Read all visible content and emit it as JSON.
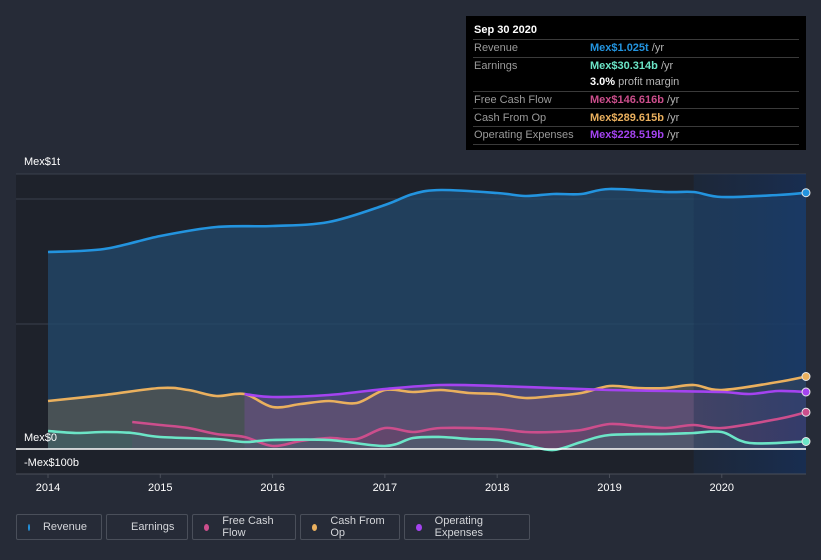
{
  "tooltip": {
    "date": "Sep 30 2020",
    "rows": [
      {
        "label": "Revenue",
        "value": "Mex$1.025t",
        "unit": " /yr",
        "color": "#2394df"
      },
      {
        "label": "Earnings",
        "value": "Mex$30.314b",
        "unit": " /yr",
        "color": "#6ce5c7"
      },
      {
        "label": "",
        "value": "3.0%",
        "unit": " profit margin",
        "color": "#ffffff"
      },
      {
        "label": "Free Cash Flow",
        "value": "Mex$146.616b",
        "unit": " /yr",
        "color": "#cc4e8c"
      },
      {
        "label": "Cash From Op",
        "value": "Mex$289.615b",
        "unit": " /yr",
        "color": "#eab05e"
      },
      {
        "label": "Operating Expenses",
        "value": "Mex$228.519b",
        "unit": " /yr",
        "color": "#a443f0"
      }
    ]
  },
  "legend": [
    {
      "label": "Revenue",
      "color": "#2394df"
    },
    {
      "label": "Earnings",
      "color": "#6ce5c7"
    },
    {
      "label": "Free Cash Flow",
      "color": "#cc4e8c"
    },
    {
      "label": "Cash From Op",
      "color": "#eab05e"
    },
    {
      "label": "Operating Expenses",
      "color": "#a443f0"
    }
  ],
  "chart_data": {
    "type": "line",
    "title": "",
    "xlabel": "",
    "ylabel": "",
    "y_unit": "billions MXN",
    "ylim": [
      -100,
      1100
    ],
    "xlim": [
      2014.0,
      2020.75
    ],
    "y_tick_labels": [
      {
        "value": 1000,
        "label": "Mex$1t"
      },
      {
        "value": 0,
        "label": "Mex$0"
      },
      {
        "value": -100,
        "label": "-Mex$100b"
      }
    ],
    "x_tick_labels": [
      "2014",
      "2015",
      "2016",
      "2017",
      "2018",
      "2019",
      "2020"
    ],
    "x_ticks": [
      2014,
      2015,
      2016,
      2017,
      2018,
      2019,
      2020
    ],
    "highlight_from": 2019.75,
    "grid": true,
    "legend_position": "bottom",
    "series": [
      {
        "name": "Revenue",
        "color": "#2394df",
        "x": [
          2014,
          2014.5,
          2015,
          2015.5,
          2016,
          2016.5,
          2017,
          2017.25,
          2017.5,
          2018,
          2018.25,
          2018.5,
          2018.75,
          2019,
          2019.5,
          2019.75,
          2020,
          2020.5,
          2020.75
        ],
        "y": [
          788,
          800,
          852,
          888,
          892,
          908,
          976,
          1020,
          1036,
          1024,
          1012,
          1020,
          1020,
          1040,
          1028,
          1028,
          1008,
          1016,
          1025
        ]
      },
      {
        "name": "Cash From Op",
        "color": "#eab05e",
        "x": [
          2014,
          2014.5,
          2015,
          2015.25,
          2015.5,
          2015.75,
          2016,
          2016.25,
          2016.5,
          2016.75,
          2017,
          2017.25,
          2017.5,
          2017.75,
          2018,
          2018.25,
          2018.5,
          2018.75,
          2019,
          2019.25,
          2019.5,
          2019.75,
          2020,
          2020.5,
          2020.75
        ],
        "y": [
          192,
          216,
          244,
          236,
          212,
          220,
          168,
          180,
          192,
          184,
          236,
          228,
          236,
          224,
          220,
          204,
          212,
          224,
          252,
          244,
          244,
          256,
          236,
          268,
          290
        ]
      },
      {
        "name": "Operating Expenses",
        "color": "#a443f0",
        "x": [
          2015.75,
          2016,
          2016.5,
          2017,
          2017.5,
          2018,
          2018.5,
          2019,
          2019.5,
          2020,
          2020.25,
          2020.5,
          2020.75
        ],
        "y": [
          220,
          208,
          216,
          240,
          256,
          252,
          244,
          236,
          232,
          228,
          220,
          232,
          228
        ]
      },
      {
        "name": "Free Cash Flow",
        "color": "#cc4e8c",
        "x": [
          2014.75,
          2015,
          2015.25,
          2015.5,
          2015.75,
          2016,
          2016.25,
          2016.5,
          2016.75,
          2017,
          2017.25,
          2017.5,
          2018,
          2018.25,
          2018.5,
          2018.75,
          2019,
          2019.25,
          2019.5,
          2019.75,
          2020,
          2020.5,
          2020.75
        ],
        "y": [
          108,
          96,
          84,
          60,
          48,
          12,
          32,
          44,
          40,
          84,
          68,
          84,
          80,
          68,
          68,
          76,
          100,
          92,
          84,
          96,
          84,
          120,
          147
        ]
      },
      {
        "name": "Earnings",
        "color": "#6ce5c7",
        "x": [
          2014,
          2014.25,
          2014.5,
          2014.75,
          2015,
          2015.5,
          2015.75,
          2016,
          2016.5,
          2017,
          2017.25,
          2017.5,
          2017.75,
          2018,
          2018.25,
          2018.5,
          2018.75,
          2019,
          2019.5,
          2019.75,
          2020,
          2020.25,
          2020.75
        ],
        "y": [
          72,
          64,
          68,
          64,
          48,
          40,
          28,
          36,
          36,
          12,
          44,
          48,
          40,
          36,
          16,
          -4,
          28,
          56,
          60,
          64,
          68,
          24,
          30
        ]
      }
    ]
  }
}
